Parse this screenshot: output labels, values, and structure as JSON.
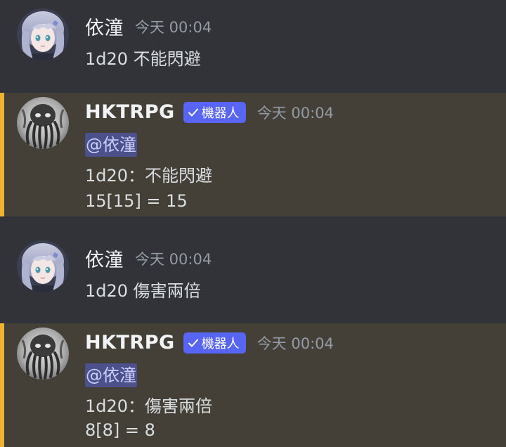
{
  "messages": [
    {
      "author": "依潼",
      "timestamp": "今天 00:04",
      "content": "1d20 不能閃避"
    },
    {
      "author": "HKTRPG",
      "bot_tag": "機器人",
      "timestamp": "今天 00:04",
      "mention": "@依潼",
      "lines": [
        "1d20：不能閃避",
        "15[15] = 15"
      ]
    },
    {
      "author": "依潼",
      "timestamp": "今天 00:04",
      "content": "1d20 傷害兩倍"
    },
    {
      "author": "HKTRPG",
      "bot_tag": "機器人",
      "timestamp": "今天 00:04",
      "mention": "@依潼",
      "lines": [
        "1d20：傷害兩倍",
        "8[8] = 8"
      ]
    }
  ],
  "colors": {
    "background": "#313338",
    "bot_message_background": "#444038",
    "bot_accent_bar": "#f0b232",
    "bot_tag": "#5865f2",
    "mention_highlight": "#5865f2"
  },
  "icons": {
    "user_avatar": "anime-girl-avatar",
    "bot_avatar": "tentacle-mask-avatar",
    "verified": "checkmark-icon"
  }
}
